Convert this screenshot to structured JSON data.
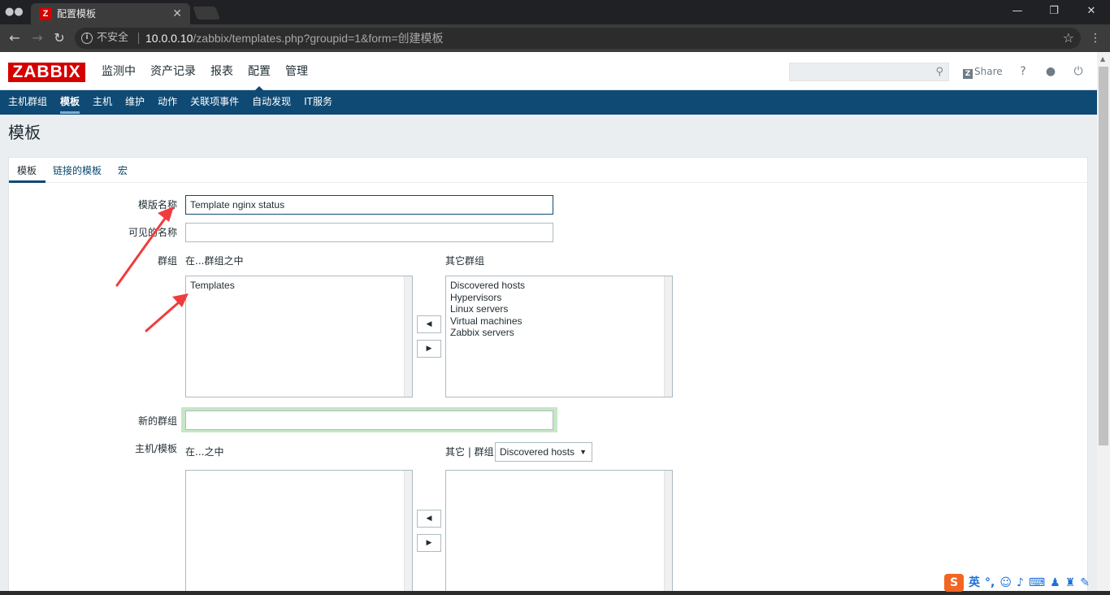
{
  "browser": {
    "tab_title": "配置模板",
    "tab_favicon": "Z",
    "insecure_label": "不安全",
    "url_host": "10.0.0.10",
    "url_path": "/zabbix/templates.php?groupid=1&form=创建模板"
  },
  "header": {
    "logo": "ZABBIX",
    "menu": [
      "监测中",
      "资产记录",
      "报表",
      "配置",
      "管理"
    ],
    "active_menu": "配置",
    "share_label": "Share",
    "help_label": "?"
  },
  "subnav": {
    "items": [
      "主机群组",
      "模板",
      "主机",
      "维护",
      "动作",
      "关联项事件",
      "自动发现",
      "IT服务"
    ],
    "active": "模板"
  },
  "page": {
    "title": "模板",
    "tabs": [
      "模板",
      "链接的模板",
      "宏"
    ]
  },
  "form": {
    "template_name_label": "模版名称",
    "template_name_value": "Template nginx status",
    "visible_name_label": "可见的名称",
    "visible_name_value": "",
    "groups_label": "群组",
    "in_groups_label": "在...群组之中",
    "other_groups_label": "其它群组",
    "in_groups": [
      "Templates"
    ],
    "other_groups": [
      "Discovered hosts",
      "Hypervisors",
      "Linux servers",
      "Virtual machines",
      "Zabbix servers"
    ],
    "new_group_label": "新的群组",
    "new_group_value": "",
    "hosts_label": "主机/模板",
    "in_hosts_label": "在...之中",
    "other_hosts_label": "其它 | 群组",
    "hosts_group_select": "Discovered hosts",
    "move_left": "◀",
    "move_right": "▶"
  },
  "ime": {
    "logo": "S",
    "mode": "英"
  },
  "colors": {
    "brand": "#d40000",
    "nav": "#0f4a74",
    "annotation_arrow": "#f03c3c"
  }
}
